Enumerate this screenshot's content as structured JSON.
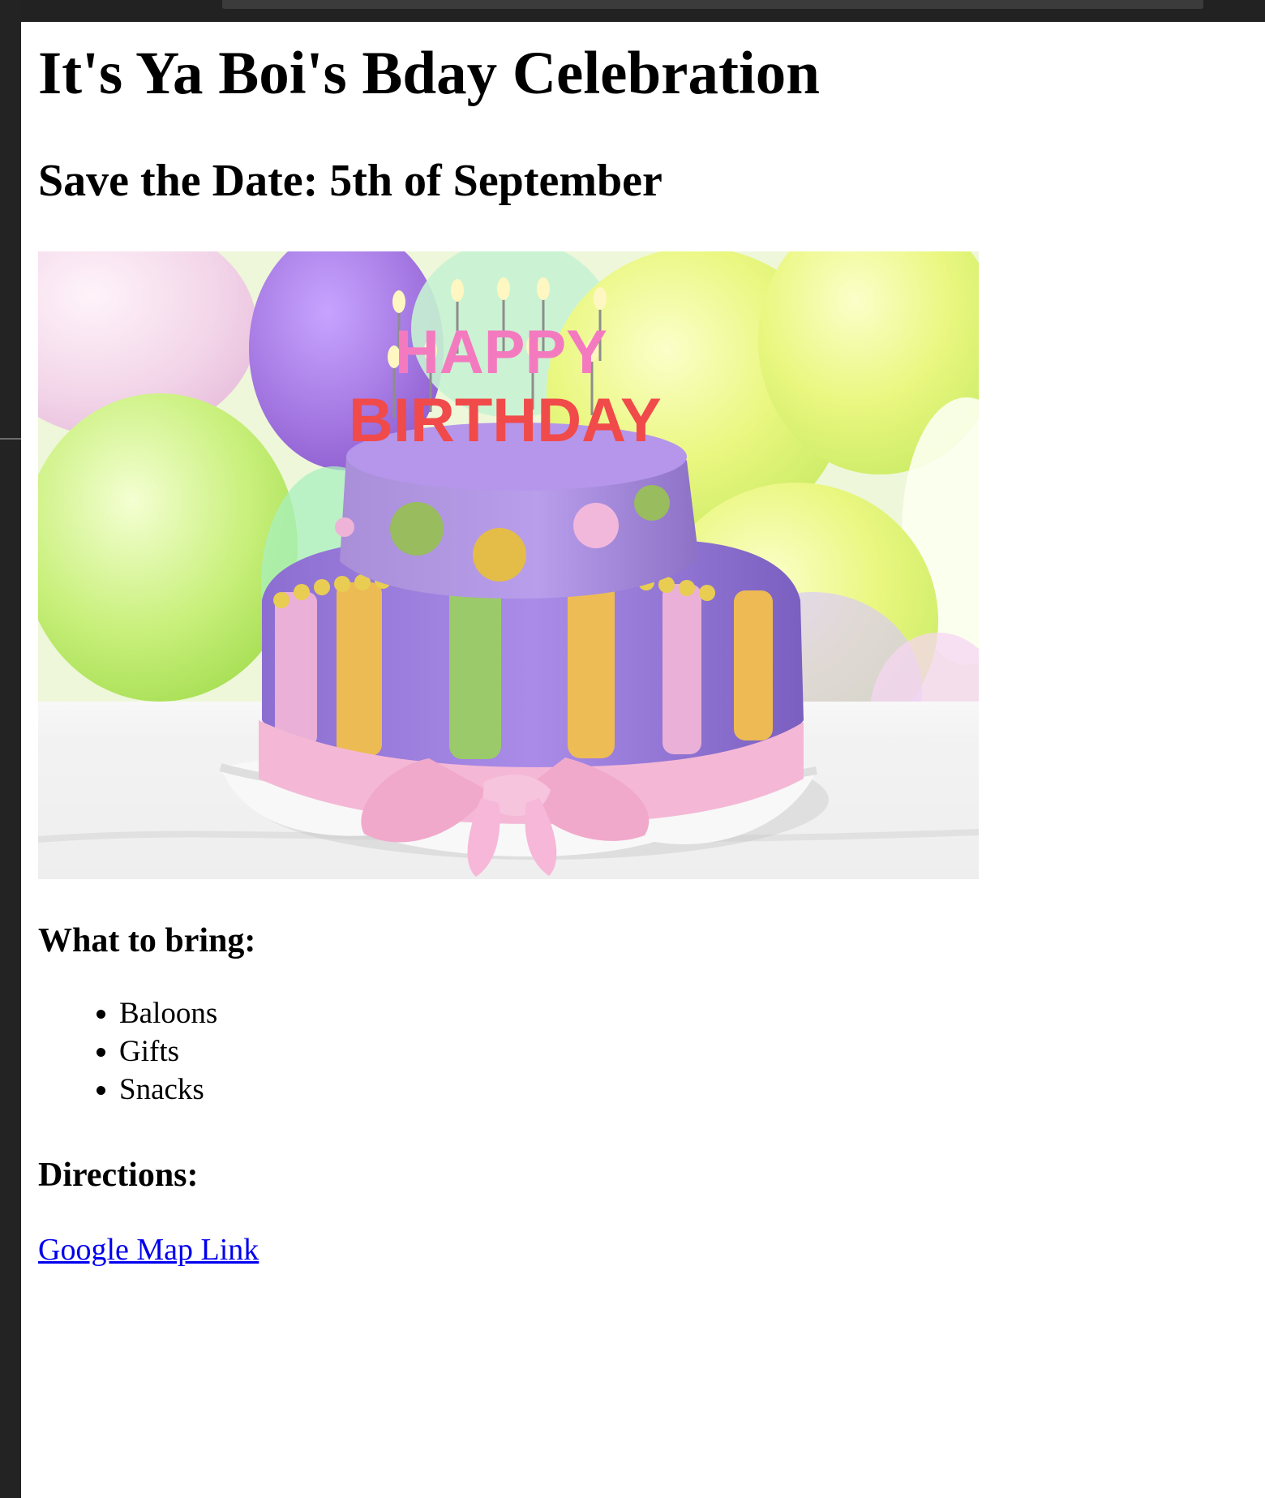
{
  "page": {
    "title": "It's Ya Boi's Bday Celebration",
    "subtitle": "Save the Date: 5th of September",
    "sections": {
      "bring": {
        "title": "What to bring:",
        "items": [
          {
            "label": "Baloons"
          },
          {
            "label": "Gifts"
          },
          {
            "label": "Snacks"
          }
        ]
      },
      "directions": {
        "title": "Directions:",
        "link_label": "Google Map Link"
      }
    },
    "image": {
      "cake_text_top": "HAPPY",
      "cake_text_bottom": "BIRTHDAY"
    },
    "colors": {
      "link": "#0000ee",
      "page_background": "#ffffff",
      "editor_background": "#1e1e1e"
    }
  }
}
